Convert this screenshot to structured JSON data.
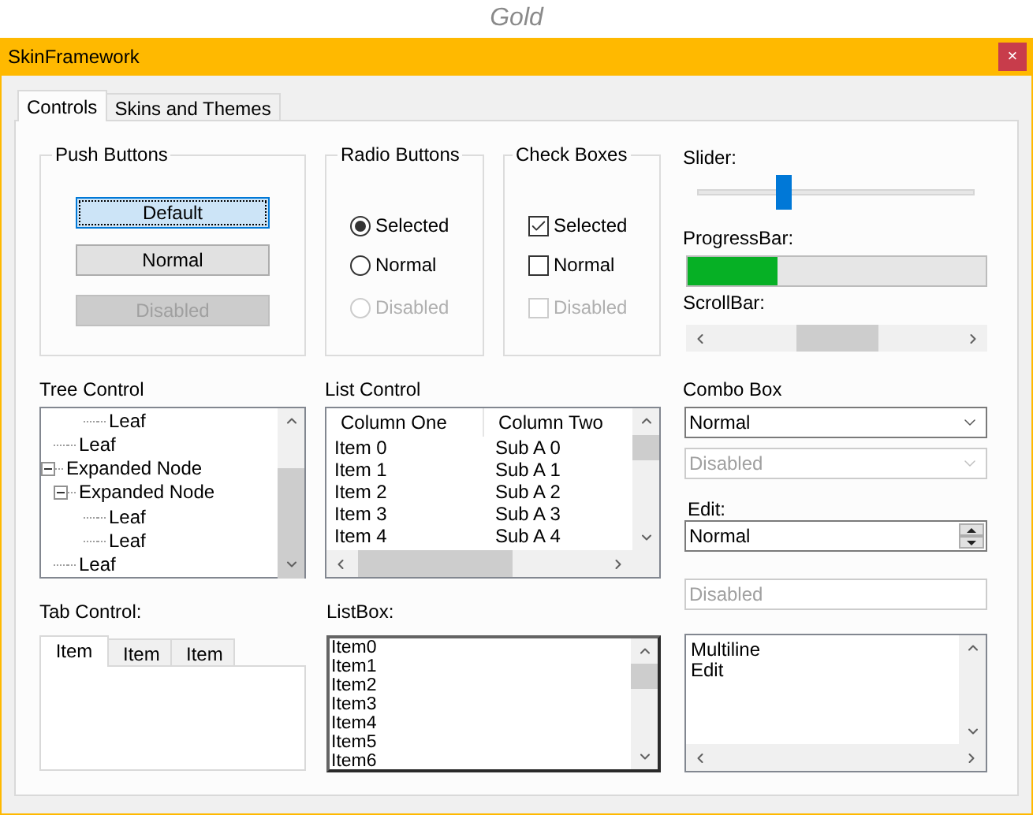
{
  "caption": "Gold",
  "window": {
    "title": "SkinFramework",
    "close": "×"
  },
  "tabs": [
    {
      "label": "Controls",
      "selected": true
    },
    {
      "label": "Skins and Themes",
      "selected": false
    }
  ],
  "push_buttons": {
    "title": "Push Buttons",
    "buttons": [
      {
        "label": "Default",
        "default": true,
        "disabled": false
      },
      {
        "label": "Normal",
        "default": false,
        "disabled": false
      },
      {
        "label": "Disabled",
        "default": false,
        "disabled": true
      }
    ]
  },
  "radio_buttons": {
    "title": "Radio Buttons",
    "items": [
      {
        "label": "Selected",
        "selected": true,
        "disabled": false
      },
      {
        "label": "Normal",
        "selected": false,
        "disabled": false
      },
      {
        "label": "Disabled",
        "selected": false,
        "disabled": true
      }
    ]
  },
  "check_boxes": {
    "title": "Check Boxes",
    "items": [
      {
        "label": "Selected",
        "checked": true,
        "disabled": false
      },
      {
        "label": "Normal",
        "checked": false,
        "disabled": false
      },
      {
        "label": "Disabled",
        "checked": false,
        "disabled": true
      }
    ]
  },
  "slider": {
    "label": "Slider:",
    "level": 0.31
  },
  "progress_bar": {
    "label": "ProgressBar:",
    "level": 0.3
  },
  "scroll_bar": {
    "label": "ScrollBar:"
  },
  "tree_control": {
    "label": "Tree Control",
    "nodes": [
      {
        "children": [
          {
            "children": [
              {
                "label": "Leaf"
              }
            ]
          },
          {
            "label": "Leaf"
          }
        ]
      },
      {
        "label": "Expanded Node",
        "expanded": true,
        "children": [
          {
            "label": "Expanded Node",
            "expanded": true,
            "children": [
              {
                "label": "Leaf"
              },
              {
                "label": "Leaf"
              }
            ]
          },
          {
            "label": "Leaf"
          }
        ]
      }
    ]
  },
  "list_control": {
    "label": "List Control",
    "columns": [
      "Column One",
      "Column Two"
    ],
    "rows": [
      [
        "Item 0",
        "Sub A 0"
      ],
      [
        "Item 1",
        "Sub A 1"
      ],
      [
        "Item 2",
        "Sub A 2"
      ],
      [
        "Item 3",
        "Sub A 3"
      ],
      [
        "Item 4",
        "Sub A 4"
      ]
    ]
  },
  "combo_box": {
    "label": "Combo Box",
    "boxes": [
      {
        "value": "Normal",
        "disabled": false
      },
      {
        "value": "Disabled",
        "disabled": true
      }
    ]
  },
  "edit": {
    "label": "Edit:",
    "fields": [
      {
        "kind": "spin",
        "value": "Normal",
        "disabled": false
      },
      {
        "kind": "plain",
        "value": "Disabled",
        "disabled": true
      }
    ]
  },
  "multiline_edit": {
    "value": "Multiline\nEdit"
  },
  "tab_control": {
    "label": "Tab Control:",
    "tabs": [
      {
        "label": "Item",
        "selected": true
      },
      {
        "label": "Item",
        "selected": false
      },
      {
        "label": "Item",
        "selected": false
      }
    ]
  },
  "list_box": {
    "label": "ListBox:",
    "items": [
      "Item0",
      "Item1",
      "Item2",
      "Item3",
      "Item4",
      "Item5",
      "Item6"
    ]
  }
}
